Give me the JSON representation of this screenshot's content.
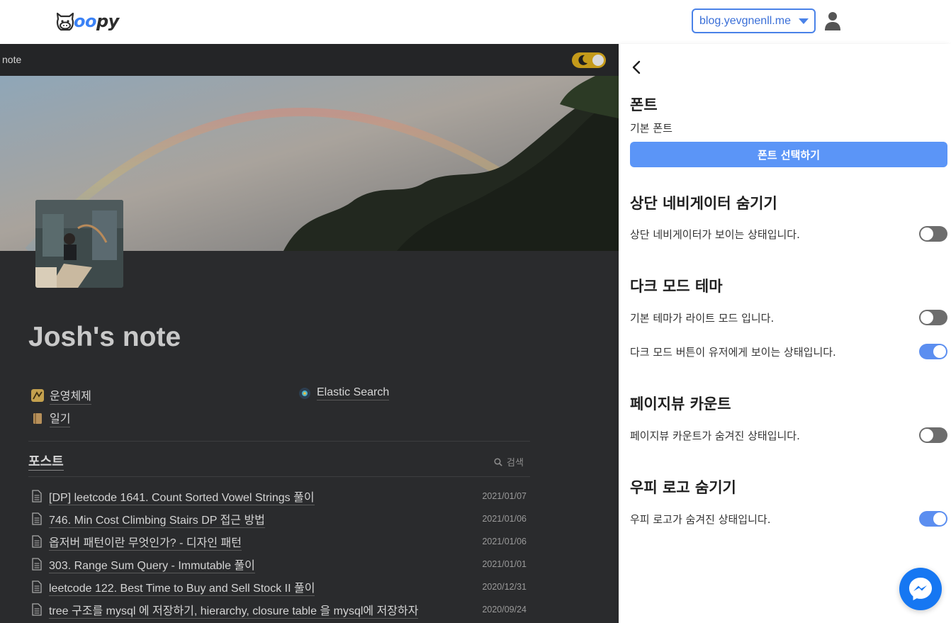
{
  "topbar": {
    "logo_text_prefix": "",
    "logo_text_oo": "oo",
    "logo_text_suffix": "py",
    "site_select_value": "blog.yevgnenll.me",
    "colors": {
      "accent": "#4a82e8"
    }
  },
  "page": {
    "breadcrumb": "note",
    "title": "Josh's note",
    "links": [
      {
        "label": "운영체제",
        "icon": "folder-emoji-icon"
      },
      {
        "label": "Elastic Search",
        "icon": "elastic-icon"
      },
      {
        "label": "일기",
        "icon": "diary-emoji-icon"
      }
    ],
    "posts_title": "포스트",
    "search_label": "검색",
    "posts": [
      {
        "title": "[DP] leetcode 1641. Count Sorted Vowel Strings 풀이",
        "date": "2021/01/07"
      },
      {
        "title": "746. Min Cost Climbing Stairs DP 접근 방법",
        "date": "2021/01/06"
      },
      {
        "title": "옵저버 패턴이란 무엇인가? - 디자인 패턴",
        "date": "2021/01/06"
      },
      {
        "title": "303. Range Sum Query - Immutable 풀이",
        "date": "2021/01/01"
      },
      {
        "title": "leetcode 122. Best Time to Buy and Sell Stock II 풀이",
        "date": "2020/12/31"
      },
      {
        "title": "tree 구조를 mysql 에 저장하기, hierarchy, closure table 을 mysql에 저장하자",
        "date": "2020/09/24"
      }
    ]
  },
  "panel": {
    "font_section": {
      "title": "폰트",
      "current": "기본 폰트",
      "button_label": "폰트 선택하기"
    },
    "nav_section": {
      "title": "상단 네비게이터 숨기기",
      "rows": [
        {
          "label": "상단 네비게이터가 보이는 상태입니다.",
          "on": false
        }
      ]
    },
    "dark_section": {
      "title": "다크 모드 테마",
      "rows": [
        {
          "label": "기본 테마가 라이트 모드 입니다.",
          "on": false
        },
        {
          "label": "다크 모드 버튼이 유저에게 보이는 상태입니다.",
          "on": true
        }
      ]
    },
    "pageview_section": {
      "title": "페이지뷰 카운트",
      "rows": [
        {
          "label": "페이지뷰 카운트가 숨겨진 상태입니다.",
          "on": false
        }
      ]
    },
    "logo_section": {
      "title": "우피 로고 숨기기",
      "rows": [
        {
          "label": "우피 로고가 숨겨진 상태입니다.",
          "on": true
        }
      ]
    },
    "colors": {
      "button": "#5b95f7",
      "toggle_on": "#5b8ef0",
      "toggle_off": "#6d6d6d"
    }
  }
}
